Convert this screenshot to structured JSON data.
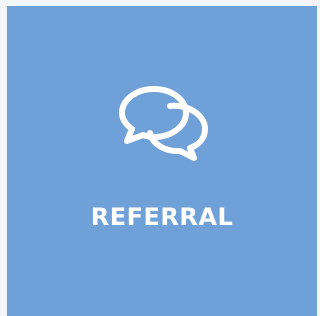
{
  "tile": {
    "label": "REFERRAL",
    "icon": "chat-bubbles-icon",
    "background_color": "#6fa1d8",
    "text_color": "#ffffff"
  }
}
